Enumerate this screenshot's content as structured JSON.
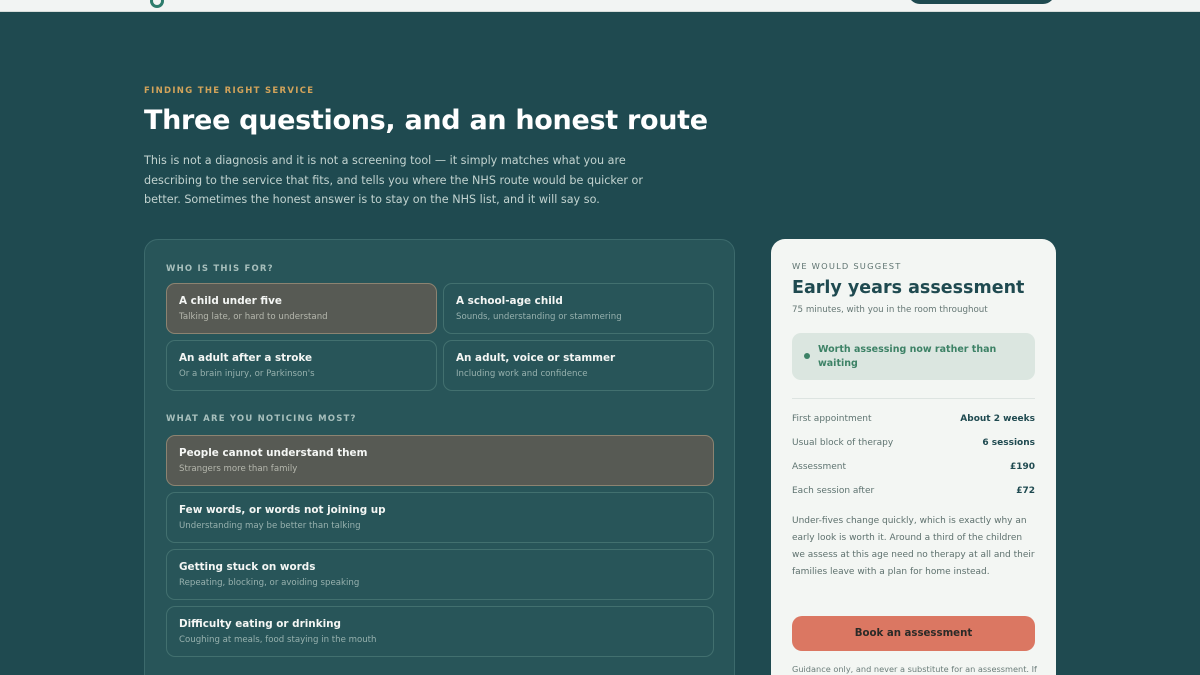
{
  "header": {},
  "hero": {
    "eyebrow": "FINDING THE RIGHT SERVICE",
    "title": "Three questions, and an honest route",
    "intro": "This is not a diagnosis and it is not a screening tool — it simply matches what you are describing to the service that fits, and tells you where the NHS route would be quicker or better. Sometimes the honest answer is to stay on the NHS list, and it will say so."
  },
  "questions": {
    "who": {
      "label": "WHO IS THIS FOR?",
      "options": [
        {
          "title": "A child under five",
          "subtitle": "Talking late, or hard to understand",
          "selected": true
        },
        {
          "title": "A school-age child",
          "subtitle": "Sounds, understanding or stammering",
          "selected": false
        },
        {
          "title": "An adult after a stroke",
          "subtitle": "Or a brain injury, or Parkinson's",
          "selected": false
        },
        {
          "title": "An adult, voice or stammer",
          "subtitle": "Including work and confidence",
          "selected": false
        }
      ]
    },
    "noticing": {
      "label": "WHAT ARE YOU NOTICING MOST?",
      "options": [
        {
          "title": "People cannot understand them",
          "subtitle": "Strangers more than family",
          "selected": true
        },
        {
          "title": "Few words, or words not joining up",
          "subtitle": "Understanding may be better than talking",
          "selected": false
        },
        {
          "title": "Getting stuck on words",
          "subtitle": "Repeating, blocking, or avoiding speaking",
          "selected": false
        },
        {
          "title": "Difficulty eating or drinking",
          "subtitle": "Coughing at meals, food staying in the mouth",
          "selected": false
        }
      ]
    }
  },
  "suggestion": {
    "eyebrow": "WE WOULD SUGGEST",
    "title": "Early years assessment",
    "subtitle": "75 minutes, with you in the room throughout",
    "advice": "Worth assessing now rather than waiting",
    "facts": [
      {
        "label": "First appointment",
        "value": "About 2 weeks"
      },
      {
        "label": "Usual block of therapy",
        "value": "6 sessions"
      },
      {
        "label": "Assessment",
        "value": "£190"
      },
      {
        "label": "Each session after",
        "value": "£72"
      }
    ],
    "body": "Under-fives change quickly, which is exactly why an early look is worth it. Around a third of the children we assess at this age need no therapy at all and their families leave with a plan for home instead.",
    "button": "Book an assessment",
    "footnote": "Guidance only, and never a substitute for an assessment. If"
  },
  "colors": {
    "page_bg": "#1f4a50",
    "accent_gold": "#d2a35a",
    "selected_option": "#575a54",
    "cta": "#db7762",
    "advice_green": "#3d8266"
  }
}
